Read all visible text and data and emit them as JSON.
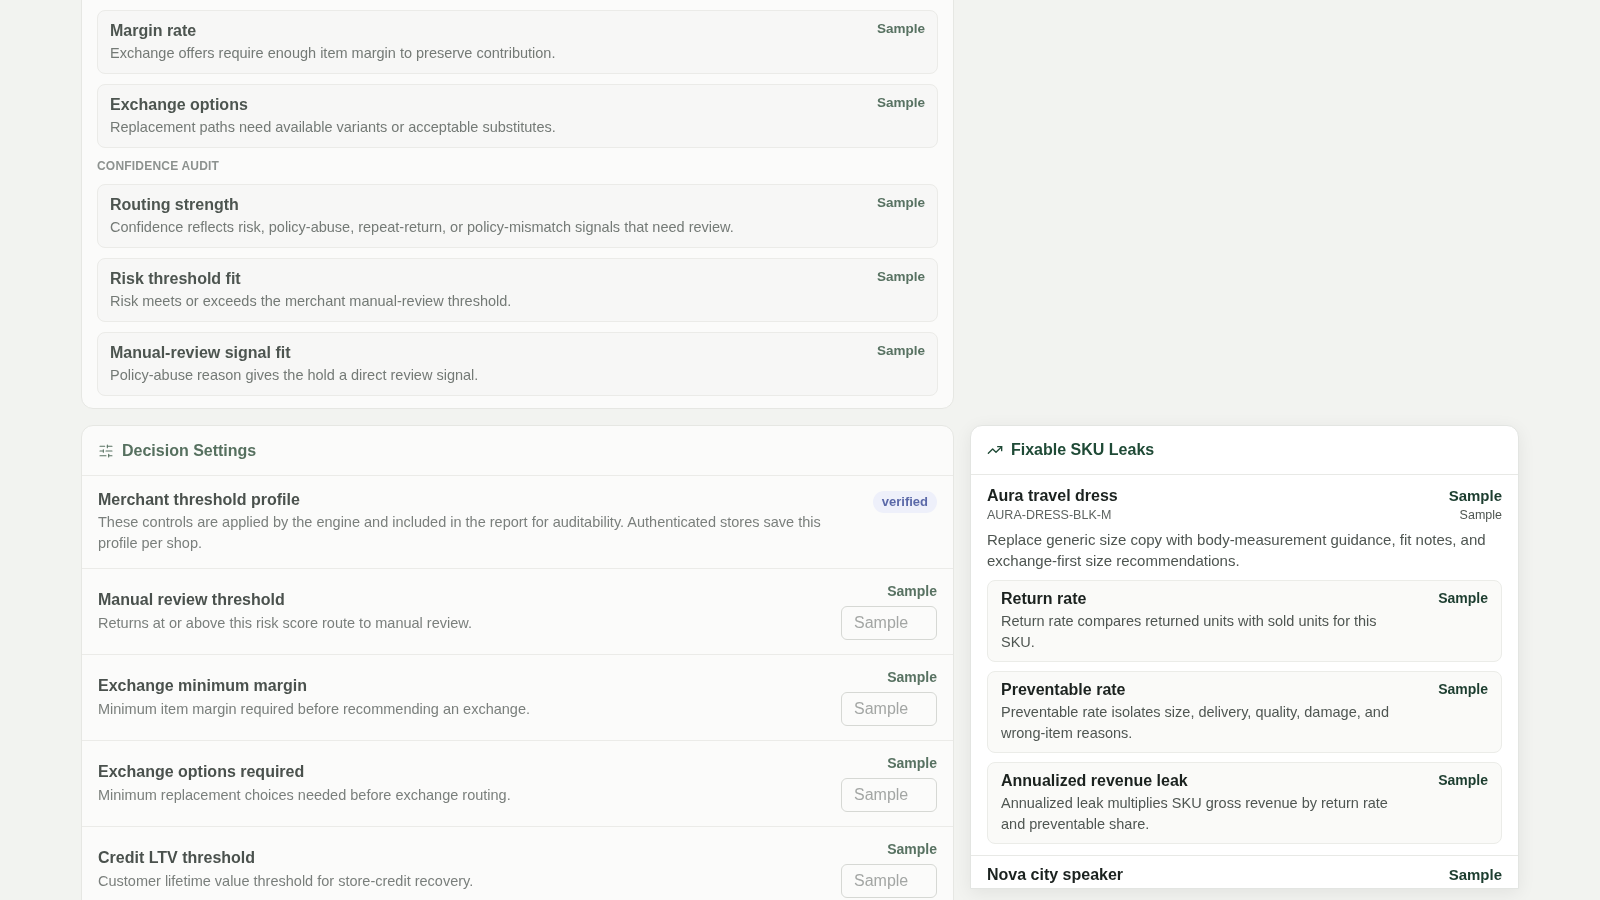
{
  "checks_panel": {
    "sections": [
      {
        "items": [
          {
            "title": "Margin rate",
            "description": "Exchange offers require enough item margin to preserve contribution.",
            "value": "Sample"
          },
          {
            "title": "Exchange options",
            "description": "Replacement paths need available variants or acceptable substitutes.",
            "value": "Sample"
          }
        ]
      },
      {
        "heading": "CONFIDENCE AUDIT",
        "items": [
          {
            "title": "Routing strength",
            "description": "Confidence reflects risk, policy-abuse, repeat-return, or policy-mismatch signals that need review.",
            "value": "Sample"
          },
          {
            "title": "Risk threshold fit",
            "description": "Risk meets or exceeds the merchant manual-review threshold.",
            "value": "Sample"
          },
          {
            "title": "Manual-review signal fit",
            "description": "Policy-abuse reason gives the hold a direct review signal.",
            "value": "Sample"
          }
        ]
      }
    ]
  },
  "decision_settings": {
    "title": "Decision Settings",
    "rows": [
      {
        "kind": "profile",
        "title": "Merchant threshold profile",
        "description": "These controls are applied by the engine and included in the report for auditability. Authenticated stores save this profile per shop.",
        "badge": "verified"
      },
      {
        "kind": "threshold",
        "title": "Manual review threshold",
        "description": "Returns at or above this risk score route to manual review.",
        "value": "Sample",
        "input": {
          "placeholder": "Sample"
        }
      },
      {
        "kind": "threshold",
        "title": "Exchange minimum margin",
        "description": "Minimum item margin required before recommending an exchange.",
        "value": "Sample",
        "input": {
          "placeholder": "Sample"
        }
      },
      {
        "kind": "threshold",
        "title": "Exchange options required",
        "description": "Minimum replacement choices needed before exchange routing.",
        "value": "Sample",
        "input": {
          "placeholder": "Sample"
        }
      },
      {
        "kind": "threshold",
        "title": "Credit LTV threshold",
        "description": "Customer lifetime value threshold for store-credit recovery.",
        "value": "Sample",
        "input": {
          "placeholder": "Sample"
        }
      }
    ]
  },
  "sku_leaks": {
    "title": "Fixable SKU Leaks",
    "skus": [
      {
        "name": "Aura travel dress",
        "sku": "AURA-DRESS-BLK-M",
        "value": "Sample",
        "sub_value": "Sample",
        "recommendation": "Replace generic size copy with body-measurement guidance, fit notes, and exchange-first size recommendations.",
        "metrics": [
          {
            "title": "Return rate",
            "description": "Return rate compares returned units with sold units for this SKU.",
            "value": "Sample"
          },
          {
            "title": "Preventable rate",
            "description": "Preventable rate isolates size, delivery, quality, damage, and wrong-item reasons.",
            "value": "Sample"
          },
          {
            "title": "Annualized revenue leak",
            "description": "Annualized leak multiplies SKU gross revenue by return rate and preventable share.",
            "value": "Sample"
          }
        ]
      },
      {
        "name": "Nova city speaker",
        "value": "Sample"
      }
    ]
  }
}
